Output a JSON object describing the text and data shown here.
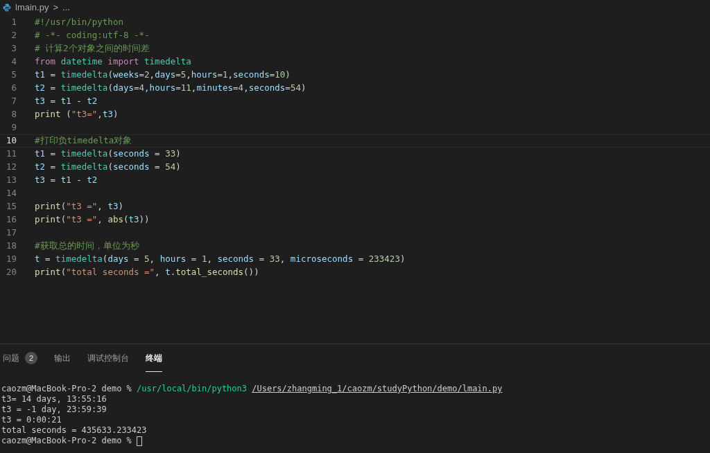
{
  "breadcrumb": {
    "file": "lmain.py",
    "separator": ">",
    "more": "..."
  },
  "code_lines": [
    {
      "number": "1",
      "current": false,
      "tokens": [
        {
          "kind": "comment",
          "text": "#!/usr/bin/python"
        }
      ]
    },
    {
      "number": "2",
      "current": false,
      "tokens": [
        {
          "kind": "comment",
          "text": "# -*- coding:utf-8 -*-"
        }
      ]
    },
    {
      "number": "3",
      "current": false,
      "tokens": [
        {
          "kind": "comment",
          "text": "# 计算2个对象之间的时间差"
        }
      ]
    },
    {
      "number": "4",
      "current": false,
      "tokens": [
        {
          "kind": "keyword",
          "text": "from"
        },
        {
          "kind": "type",
          "text": " datetime"
        },
        {
          "kind": "keyword",
          "text": " import"
        },
        {
          "kind": "type",
          "text": " timedelta"
        }
      ]
    },
    {
      "number": "5",
      "current": false,
      "tokens": [
        {
          "kind": "var",
          "text": "t1"
        },
        {
          "kind": "plain",
          "text": " = "
        },
        {
          "kind": "type",
          "text": "timedelta"
        },
        {
          "kind": "plain",
          "text": "("
        },
        {
          "kind": "var",
          "text": "weeks"
        },
        {
          "kind": "plain",
          "text": "="
        },
        {
          "kind": "number",
          "text": "2"
        },
        {
          "kind": "plain",
          "text": ","
        },
        {
          "kind": "var",
          "text": "days"
        },
        {
          "kind": "plain",
          "text": "="
        },
        {
          "kind": "number",
          "text": "5"
        },
        {
          "kind": "plain",
          "text": ","
        },
        {
          "kind": "var",
          "text": "hours"
        },
        {
          "kind": "plain",
          "text": "="
        },
        {
          "kind": "number",
          "text": "1"
        },
        {
          "kind": "plain",
          "text": ","
        },
        {
          "kind": "var",
          "text": "seconds"
        },
        {
          "kind": "plain",
          "text": "="
        },
        {
          "kind": "number",
          "text": "10"
        },
        {
          "kind": "plain",
          "text": ")"
        }
      ]
    },
    {
      "number": "6",
      "current": false,
      "tokens": [
        {
          "kind": "var",
          "text": "t2"
        },
        {
          "kind": "plain",
          "text": " = "
        },
        {
          "kind": "type",
          "text": "timedelta"
        },
        {
          "kind": "plain",
          "text": "("
        },
        {
          "kind": "var",
          "text": "days"
        },
        {
          "kind": "plain",
          "text": "="
        },
        {
          "kind": "number",
          "text": "4"
        },
        {
          "kind": "plain",
          "text": ","
        },
        {
          "kind": "var",
          "text": "hours"
        },
        {
          "kind": "plain",
          "text": "="
        },
        {
          "kind": "number",
          "text": "11"
        },
        {
          "kind": "plain",
          "text": ","
        },
        {
          "kind": "var",
          "text": "minutes"
        },
        {
          "kind": "plain",
          "text": "="
        },
        {
          "kind": "number",
          "text": "4"
        },
        {
          "kind": "plain",
          "text": ","
        },
        {
          "kind": "var",
          "text": "seconds"
        },
        {
          "kind": "plain",
          "text": "="
        },
        {
          "kind": "number",
          "text": "54"
        },
        {
          "kind": "plain",
          "text": ")"
        }
      ]
    },
    {
      "number": "7",
      "current": false,
      "tokens": [
        {
          "kind": "var",
          "text": "t3"
        },
        {
          "kind": "plain",
          "text": " = "
        },
        {
          "kind": "var",
          "text": "t1"
        },
        {
          "kind": "plain",
          "text": " - "
        },
        {
          "kind": "var",
          "text": "t2"
        }
      ]
    },
    {
      "number": "8",
      "current": false,
      "tokens": [
        {
          "kind": "func",
          "text": "print"
        },
        {
          "kind": "plain",
          "text": " ("
        },
        {
          "kind": "string",
          "text": "\"t3=\""
        },
        {
          "kind": "plain",
          "text": ","
        },
        {
          "kind": "var",
          "text": "t3"
        },
        {
          "kind": "plain",
          "text": ")"
        }
      ]
    },
    {
      "number": "9",
      "current": false
    },
    {
      "number": "10",
      "current": true,
      "tokens": [
        {
          "kind": "comment",
          "text": "#打印负timedelta对象"
        }
      ]
    },
    {
      "number": "11",
      "current": false,
      "tokens": [
        {
          "kind": "var",
          "text": "t1"
        },
        {
          "kind": "plain",
          "text": " = "
        },
        {
          "kind": "type",
          "text": "timedelta"
        },
        {
          "kind": "plain",
          "text": "("
        },
        {
          "kind": "var",
          "text": "seconds"
        },
        {
          "kind": "plain",
          "text": " = "
        },
        {
          "kind": "number",
          "text": "33"
        },
        {
          "kind": "plain",
          "text": ")"
        }
      ]
    },
    {
      "number": "12",
      "current": false,
      "tokens": [
        {
          "kind": "var",
          "text": "t2"
        },
        {
          "kind": "plain",
          "text": " = "
        },
        {
          "kind": "type",
          "text": "timedelta"
        },
        {
          "kind": "plain",
          "text": "("
        },
        {
          "kind": "var",
          "text": "seconds"
        },
        {
          "kind": "plain",
          "text": " = "
        },
        {
          "kind": "number",
          "text": "54"
        },
        {
          "kind": "plain",
          "text": ")"
        }
      ]
    },
    {
      "number": "13",
      "current": false,
      "tokens": [
        {
          "kind": "var",
          "text": "t3"
        },
        {
          "kind": "plain",
          "text": " = "
        },
        {
          "kind": "var",
          "text": "t1"
        },
        {
          "kind": "plain",
          "text": " - "
        },
        {
          "kind": "var",
          "text": "t2"
        }
      ]
    },
    {
      "number": "14",
      "current": false
    },
    {
      "number": "15",
      "current": false,
      "tokens": [
        {
          "kind": "func",
          "text": "print"
        },
        {
          "kind": "plain",
          "text": "("
        },
        {
          "kind": "string",
          "text": "\"t3 =\""
        },
        {
          "kind": "plain",
          "text": ", "
        },
        {
          "kind": "var",
          "text": "t3"
        },
        {
          "kind": "plain",
          "text": ")"
        }
      ]
    },
    {
      "number": "16",
      "current": false,
      "tokens": [
        {
          "kind": "func",
          "text": "print"
        },
        {
          "kind": "plain",
          "text": "("
        },
        {
          "kind": "string",
          "text": "\"t3 =\""
        },
        {
          "kind": "plain",
          "text": ", "
        },
        {
          "kind": "func",
          "text": "abs"
        },
        {
          "kind": "plain",
          "text": "("
        },
        {
          "kind": "var",
          "text": "t3"
        },
        {
          "kind": "plain",
          "text": "))"
        }
      ]
    },
    {
      "number": "17",
      "current": false
    },
    {
      "number": "18",
      "current": false,
      "tokens": [
        {
          "kind": "comment",
          "text": "#获取总的时间，单位为秒"
        }
      ]
    },
    {
      "number": "19",
      "current": false,
      "tokens": [
        {
          "kind": "var",
          "text": "t"
        },
        {
          "kind": "plain",
          "text": " = "
        },
        {
          "kind": "type",
          "text": "timedelta"
        },
        {
          "kind": "plain",
          "text": "("
        },
        {
          "kind": "var",
          "text": "days"
        },
        {
          "kind": "plain",
          "text": " = "
        },
        {
          "kind": "number",
          "text": "5"
        },
        {
          "kind": "plain",
          "text": ", "
        },
        {
          "kind": "var",
          "text": "hours"
        },
        {
          "kind": "plain",
          "text": " = "
        },
        {
          "kind": "number",
          "text": "1"
        },
        {
          "kind": "plain",
          "text": ", "
        },
        {
          "kind": "var",
          "text": "seconds"
        },
        {
          "kind": "plain",
          "text": " = "
        },
        {
          "kind": "number",
          "text": "33"
        },
        {
          "kind": "plain",
          "text": ", "
        },
        {
          "kind": "var",
          "text": "microseconds"
        },
        {
          "kind": "plain",
          "text": " = "
        },
        {
          "kind": "number",
          "text": "233423"
        },
        {
          "kind": "plain",
          "text": ")"
        }
      ]
    },
    {
      "number": "20",
      "current": false,
      "tokens": [
        {
          "kind": "func",
          "text": "print"
        },
        {
          "kind": "plain",
          "text": "("
        },
        {
          "kind": "string",
          "text": "\"total seconds =\""
        },
        {
          "kind": "plain",
          "text": ", "
        },
        {
          "kind": "var",
          "text": "t"
        },
        {
          "kind": "plain",
          "text": "."
        },
        {
          "kind": "func",
          "text": "total_seconds"
        },
        {
          "kind": "plain",
          "text": "())"
        }
      ]
    }
  ],
  "panel_tabs": [
    {
      "label": "问题",
      "badge": "2",
      "selected": false
    },
    {
      "label": "输出",
      "selected": false
    },
    {
      "label": "调试控制台",
      "selected": false
    },
    {
      "label": "终端",
      "selected": true
    }
  ],
  "terminal_lines": [
    {
      "tokens": [
        {
          "kind": "plain",
          "text": "caozm@MacBook-Pro-2 demo % "
        },
        {
          "kind": "command",
          "text": "/usr/local/bin/python3 "
        },
        {
          "kind": "link",
          "text": "/Users/zhangming_1/caozm/studyPython/demo/lmain.py"
        }
      ]
    },
    {
      "tokens": [
        {
          "kind": "plain",
          "text": "t3= 14 days, 13:55:16"
        }
      ]
    },
    {
      "tokens": [
        {
          "kind": "plain",
          "text": "t3 = -1 day, 23:59:39"
        }
      ]
    },
    {
      "tokens": [
        {
          "kind": "plain",
          "text": "t3 = 0:00:21"
        }
      ]
    },
    {
      "tokens": [
        {
          "kind": "plain",
          "text": "total seconds = 435633.233423"
        }
      ]
    },
    {
      "tokens": [
        {
          "kind": "plain",
          "text": "caozm@MacBook-Pro-2 demo % "
        }
      ],
      "cursor": true
    }
  ]
}
